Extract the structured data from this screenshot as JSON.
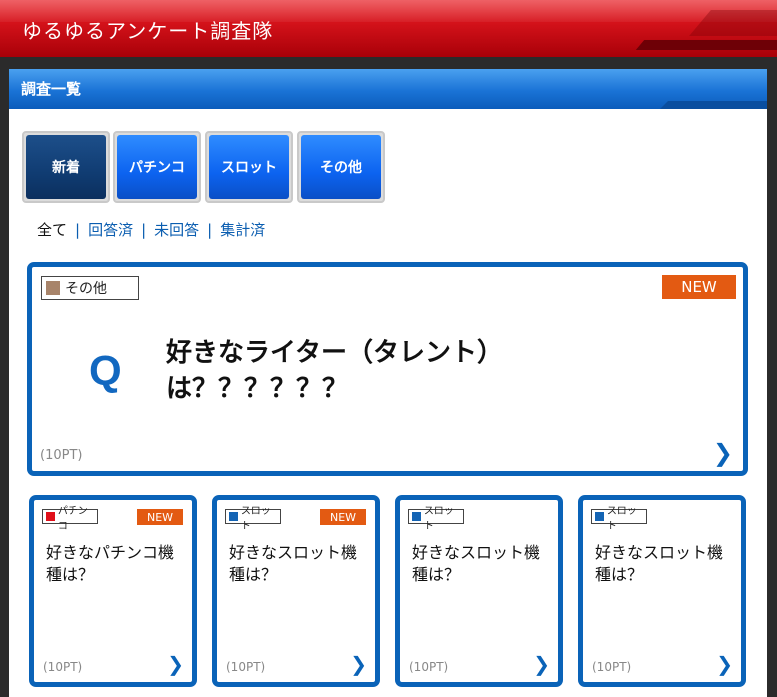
{
  "app": {
    "title": "ゆるゆるアンケート調査隊"
  },
  "panel": {
    "title": "調査一覧"
  },
  "categories": [
    {
      "label": "新着",
      "active": true
    },
    {
      "label": "パチンコ",
      "active": false
    },
    {
      "label": "スロット",
      "active": false
    },
    {
      "label": "その他",
      "active": false
    }
  ],
  "filters": [
    {
      "label": "全て",
      "current": true
    },
    {
      "label": "回答済",
      "current": false
    },
    {
      "label": "未回答",
      "current": false
    },
    {
      "label": "集計済",
      "current": false
    }
  ],
  "filter_separator": "|",
  "featured": {
    "tag": "その他",
    "tag_color": "#a8846a",
    "badge": "NEW",
    "q_mark": "Q",
    "question_line1": "好きなライター（タレント）",
    "question_line2": "は？？？？？？",
    "points": "(10PT)",
    "icon": "chevron-right-icon"
  },
  "cards": [
    {
      "tag": "パチンコ",
      "tag_color": "#e0101a",
      "badge": "NEW",
      "question_line1": "好きなパチンコ機",
      "question_line2": "種は？",
      "points": "(10PT)"
    },
    {
      "tag": "スロット",
      "tag_color": "#1464b4",
      "badge": "NEW",
      "question_line1": "好きなスロット機",
      "question_line2": "種は？",
      "points": "(10PT)"
    },
    {
      "tag": "スロット",
      "tag_color": "#1464b4",
      "badge": "",
      "question_line1": "好きなスロット機",
      "question_line2": "種は？",
      "points": "(10PT)"
    },
    {
      "tag": "スロット",
      "tag_color": "#1464b4",
      "badge": "",
      "question_line1": "好きなスロット機",
      "question_line2": "種は？",
      "points": "(10PT)"
    }
  ],
  "chevron_glyph": "❯",
  "colors": {
    "accent_blue": "#0a63b8",
    "header_red": "#d4121a",
    "new_orange": "#e35a12"
  }
}
